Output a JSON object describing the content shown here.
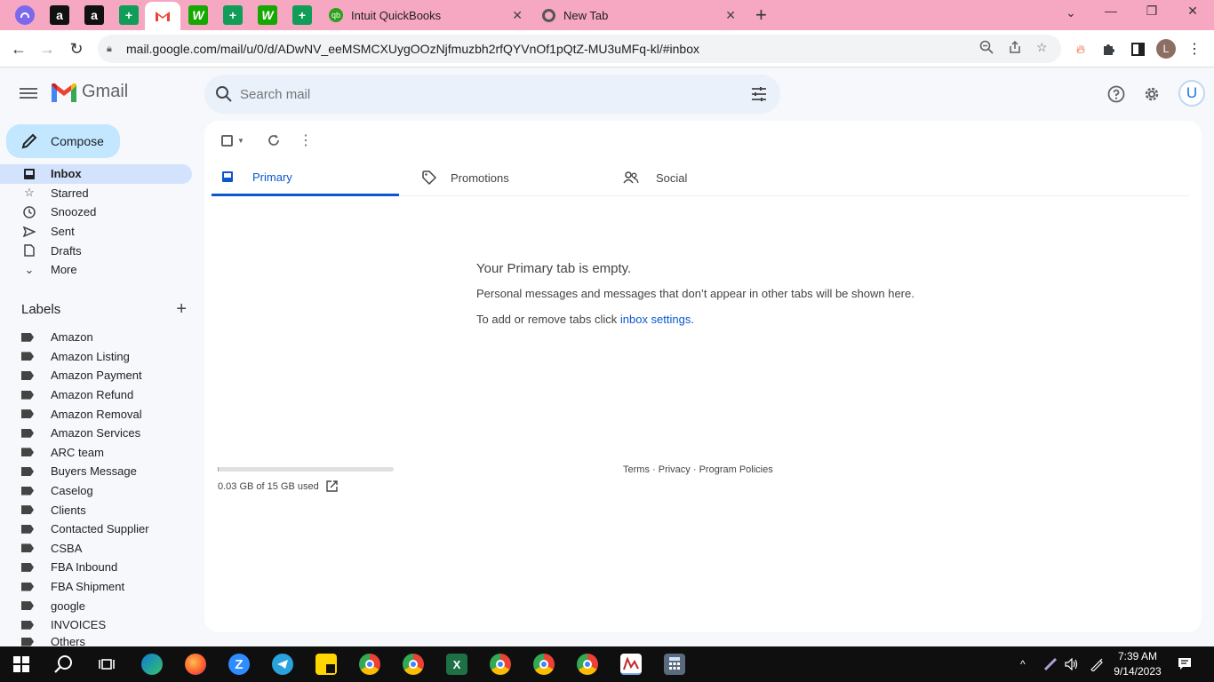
{
  "browser": {
    "tabs": [
      {
        "icon": "clickup-icon",
        "label": ""
      },
      {
        "icon": "amazon-icon",
        "label": "a"
      },
      {
        "icon": "amazon-icon",
        "label": "a"
      },
      {
        "icon": "sheets-icon",
        "label": "+"
      },
      {
        "icon": "gmail-icon",
        "label": "M",
        "active": true
      },
      {
        "icon": "upwork-icon",
        "label": "W"
      },
      {
        "icon": "sheets-icon",
        "label": "+"
      },
      {
        "icon": "upwork-icon",
        "label": "W"
      },
      {
        "icon": "sheets-icon",
        "label": "+"
      }
    ],
    "tab_quickbooks": "Intuit QuickBooks",
    "tab_newtab": "New Tab",
    "new_tab_button": "+",
    "url": "mail.google.com/mail/u/0/d/ADwNV_eeMSMCXUygOOzNjfmuzbh2rfQYVnOf1pQtZ-MU3uMFq-kl/#inbox",
    "profile_initial": "L"
  },
  "gmail": {
    "product_name": "Gmail",
    "search_placeholder": "Search mail",
    "account_initial": "U",
    "compose_label": "Compose",
    "nav": [
      {
        "label": "Inbox",
        "icon": "inbox-icon",
        "selected": true
      },
      {
        "label": "Starred",
        "icon": "star-icon"
      },
      {
        "label": "Snoozed",
        "icon": "clock-icon"
      },
      {
        "label": "Sent",
        "icon": "send-icon"
      },
      {
        "label": "Drafts",
        "icon": "draft-icon"
      },
      {
        "label": "More",
        "icon": "chevron-down-icon"
      }
    ],
    "labels_header": "Labels",
    "labels": [
      "Amazon",
      "Amazon Listing",
      "Amazon Payment",
      "Amazon Refund",
      "Amazon Removal",
      "Amazon Services",
      "ARC team",
      "Buyers Message",
      "Caselog",
      "Clients",
      "Contacted Supplier",
      "CSBA",
      "FBA Inbound",
      "FBA Shipment",
      "google",
      "INVOICES",
      "Others"
    ],
    "category_tabs": [
      {
        "label": "Primary",
        "icon": "inbox-icon",
        "selected": true
      },
      {
        "label": "Promotions",
        "icon": "tag-icon"
      },
      {
        "label": "Social",
        "icon": "people-icon"
      }
    ],
    "empty_title": "Your Primary tab is empty.",
    "empty_line1": "Personal messages and messages that don’t appear in other tabs will be shown here.",
    "empty_line2_prefix": "To add or remove tabs click ",
    "empty_line2_link": "inbox settings",
    "empty_line2_suffix": ".",
    "storage_text": "0.03 GB of 15 GB used",
    "storage_fraction": 0.002,
    "footer_terms": "Terms",
    "footer_sep": " · ",
    "footer_privacy": "Privacy",
    "footer_policies": "Program Policies"
  },
  "taskbar": {
    "time": "7:39 AM",
    "date": "9/14/2023"
  },
  "colors": {
    "tabbar": "#f6a7c1",
    "accent": "#0b57d0",
    "compose": "#c2e7ff",
    "selected_nav": "#d3e3fd"
  }
}
